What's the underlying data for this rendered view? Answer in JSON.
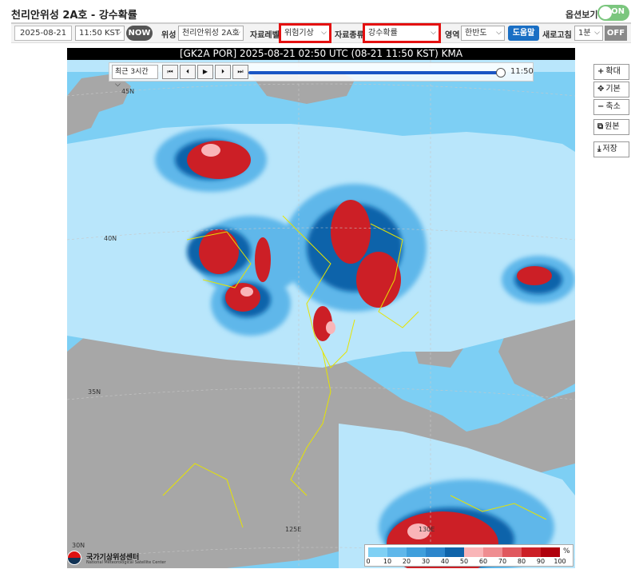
{
  "app": {
    "title": "천리안위성 2A호 - 강수확률"
  },
  "options": {
    "label": "옵션보기",
    "toggle": "ON"
  },
  "toolbar": {
    "date": "2025-08-21",
    "time": "11:50 KST",
    "now_label": "NOW",
    "satellite_label": "위성",
    "satellite_value": "천리안위성 2A호",
    "level_label": "자료레벨",
    "level_value": "위험기상",
    "type_label": "자료종류",
    "type_value": "강수확률",
    "region_label": "영역",
    "region_value": "한반도",
    "help_label": "도움말",
    "refresh_label": "새로고침",
    "refresh_value": "1분",
    "refresh_toggle": "OFF"
  },
  "map": {
    "title": "[GK2A POR] 2025-08-21 02:50 UTC (08-21 11:50 KST) KMA",
    "range_select": "최근 3시간",
    "current_time": "11:50",
    "progress_fraction": 1.0,
    "gridlabels": [
      "45N",
      "40N",
      "35N",
      "30N",
      "125E",
      "130E"
    ]
  },
  "side": {
    "zoom_in": "확대",
    "reset": "기본",
    "zoom_out": "축소",
    "original": "원본",
    "save": "저장"
  },
  "legend": {
    "unit": "%",
    "ticks": [
      "0",
      "10",
      "20",
      "30",
      "40",
      "50",
      "60",
      "70",
      "80",
      "90",
      "100"
    ],
    "colors": [
      "#b9e6fb",
      "#7fd0f4",
      "#5fb7ea",
      "#3f9fdc",
      "#2c86cc",
      "#0f64aa",
      "#f9b5b8",
      "#ef8d91",
      "#e0585e",
      "#cc1f26",
      "#b0000c"
    ]
  },
  "logo": {
    "name": "국가기상위성센터",
    "sub": "National Meteorological Satellite Center"
  }
}
